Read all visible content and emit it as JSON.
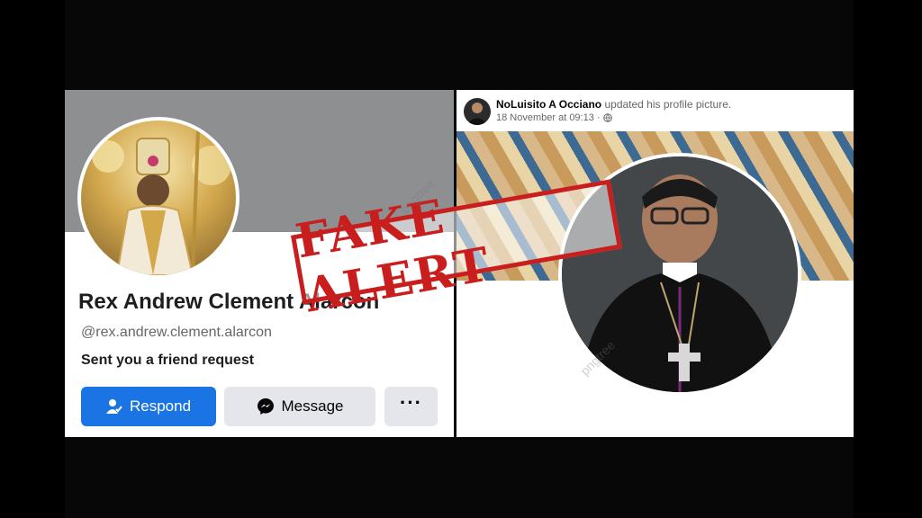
{
  "left_profile": {
    "name": "Rex Andrew Clement Alarcon",
    "handle": "@rex.andrew.clement.alarcon",
    "friend_request_text": "Sent you a friend request",
    "buttons": {
      "respond": "Respond",
      "message": "Message",
      "more": "···"
    },
    "icons": {
      "respond": "person-check-icon",
      "message": "messenger-icon"
    }
  },
  "right_post": {
    "author": "NoLuisito A Occiano",
    "action": "updated his profile picture.",
    "date": "18 November at 09:13 ·",
    "privacy_icon": "globe-icon"
  },
  "stamp": {
    "text": "FAKE ALERT",
    "color": "#c81e1e"
  },
  "watermark": "pngtree",
  "colors": {
    "facebook_blue": "#1b74e4",
    "button_gray": "#e4e6eb",
    "stamp_red": "#c81e1e"
  }
}
